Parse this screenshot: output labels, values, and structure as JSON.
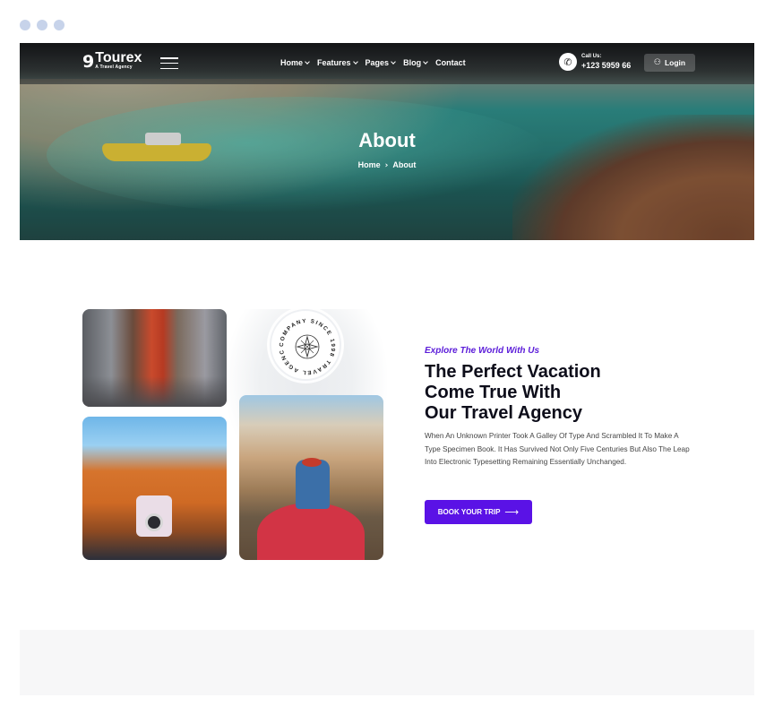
{
  "window": {
    "controls": [
      "dot",
      "dot",
      "dot"
    ]
  },
  "nav": {
    "logo_mark": "9",
    "logo_name": "Tourex",
    "logo_tagline": "A Travel Agency",
    "menu": [
      {
        "label": "Home",
        "has_dropdown": true
      },
      {
        "label": "Features",
        "has_dropdown": true
      },
      {
        "label": "Pages",
        "has_dropdown": true
      },
      {
        "label": "Blog",
        "has_dropdown": true
      },
      {
        "label": "Contact",
        "has_dropdown": false
      }
    ],
    "call_label": "Call Us:",
    "call_number": "+123 5959 66",
    "login_label": "Login",
    "icons": {
      "phone": "phone-icon",
      "user": "user-icon",
      "menu": "hamburger-icon"
    }
  },
  "hero": {
    "title": "About",
    "breadcrumb": {
      "home": "Home",
      "separator": "›",
      "current": "About"
    }
  },
  "about": {
    "badge_text": "COMPANY SINCE 1998 TRAVEL AGENCY",
    "eyebrow": "Explore The World With Us",
    "heading_lines": [
      "The Perfect Vacation",
      "Come True With",
      "Our Travel Agency"
    ],
    "paragraph": "When An Unknown Printer Took A Galley Of Type And Scrambled It To Make A Type Specimen Book. It Has Survived Not Only Five Centuries But Also The Leap Into Electronic Typesetting Remaining Essentially Unchanged.",
    "cta_label": "BOOK YOUR TRIP",
    "accent_color": "#5a12e6"
  }
}
